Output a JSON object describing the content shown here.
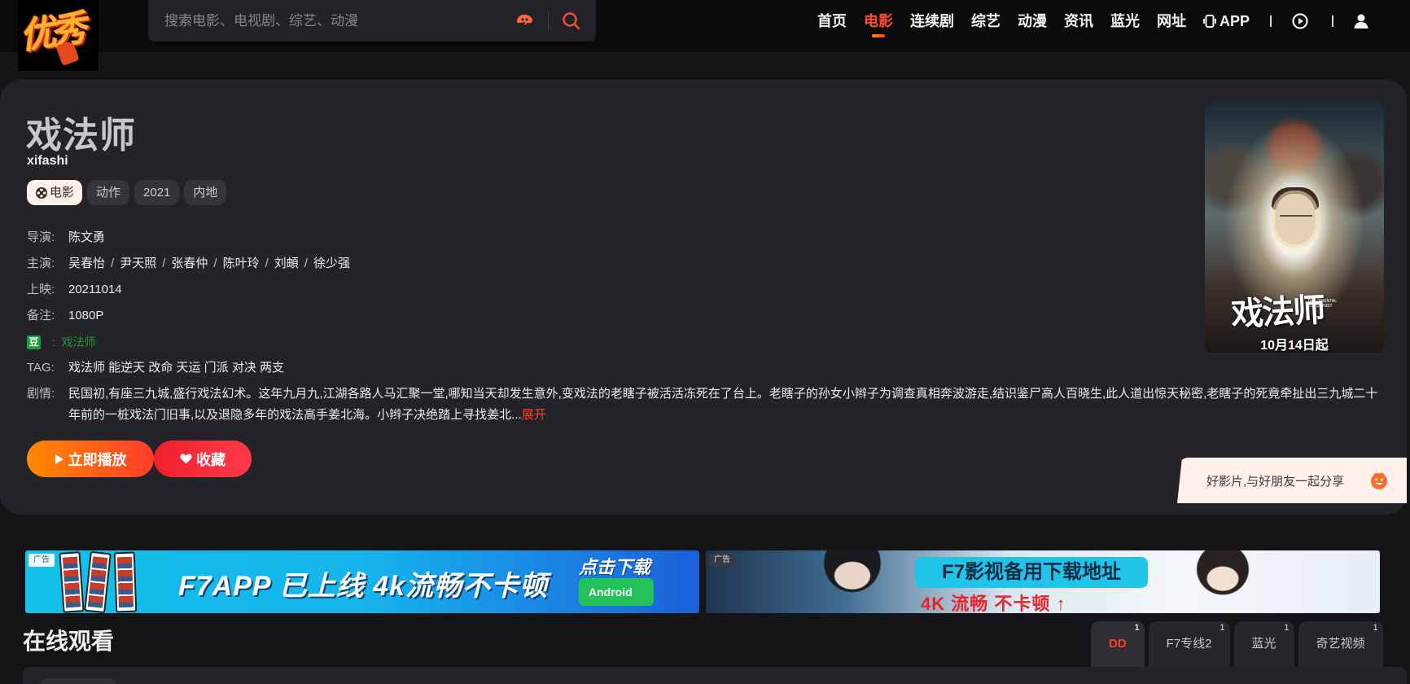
{
  "header": {
    "logo_text": "优秀",
    "search_placeholder": "搜索电影、电视剧、综艺、动漫",
    "nav": [
      {
        "label": "首页",
        "active": false
      },
      {
        "label": "电影",
        "active": true
      },
      {
        "label": "连续剧",
        "active": false
      },
      {
        "label": "综艺",
        "active": false
      },
      {
        "label": "动漫",
        "active": false
      },
      {
        "label": "资讯",
        "active": false
      },
      {
        "label": "蓝光",
        "active": false
      },
      {
        "label": "网址",
        "active": false,
        "badge": "+"
      }
    ],
    "app_label": "APP",
    "icons": [
      "search-icon",
      "voice-icon",
      "history-play-icon",
      "user-icon"
    ],
    "accent_color": "#ff4b2b"
  },
  "movie": {
    "title": "戏法师",
    "pinyin": "xifashi",
    "tags": [
      "电影",
      "动作",
      "2021",
      "内地"
    ],
    "director_label": "导演:",
    "director": "陈文勇",
    "cast_label": "主演:",
    "cast": [
      "吴春怡",
      "尹天照",
      "张春仲",
      "陈叶玲",
      "刘頔",
      "徐少强"
    ],
    "release_label": "上映:",
    "release": "20211014",
    "remark_label": "备注:",
    "remark": "1080P",
    "douban_badge": "豆",
    "douban_sep": ":",
    "douban_title": "戏法师",
    "tag_label": "TAG:",
    "tag_values": "戏法师 能逆天 改命 天运 门派 对决 两支",
    "plot_label": "剧情:",
    "plot": "民国初,有座三九城,盛行戏法幻术。这年九月九,江湖各路人马汇聚一堂,哪知当天却发生意外,变戏法的老瞎子被活活冻死在了台上。老瞎子的孙女小辫子为调查真相奔波游走,结识鉴尸高人百晓生,此人道出惊天秘密,老瞎子的死竟牵扯出三九城二十年前的一桩戏法门旧事,以及退隐多年的戏法高手姜北海。小辫子决绝踏上寻找姜北...",
    "expand_label": "展开",
    "play_button": "立即播放",
    "fav_button": "收藏",
    "poster_title": "戏法师",
    "poster_en": "THE ORIENTAL ILLUSIONIST",
    "poster_date": "10月14日起",
    "share_text": "好影片,与好朋友一起分享"
  },
  "ads": [
    {
      "badge": "广告",
      "text": "F7APP 已上线 4k流畅不卡顿",
      "download": "点击下载",
      "platform": "Android"
    },
    {
      "badge": "广告",
      "text": "F7影视备用下载地址",
      "sub": "4K 流畅 不卡顿 ↑"
    }
  ],
  "online": {
    "title": "在线观看",
    "sources": [
      {
        "label": "DD",
        "count": "1",
        "active": true
      },
      {
        "label": "F7专线2",
        "count": "1",
        "active": false
      },
      {
        "label": "蓝光",
        "count": "1",
        "active": false
      },
      {
        "label": "奇艺视频",
        "count": "1",
        "active": false
      }
    ]
  }
}
